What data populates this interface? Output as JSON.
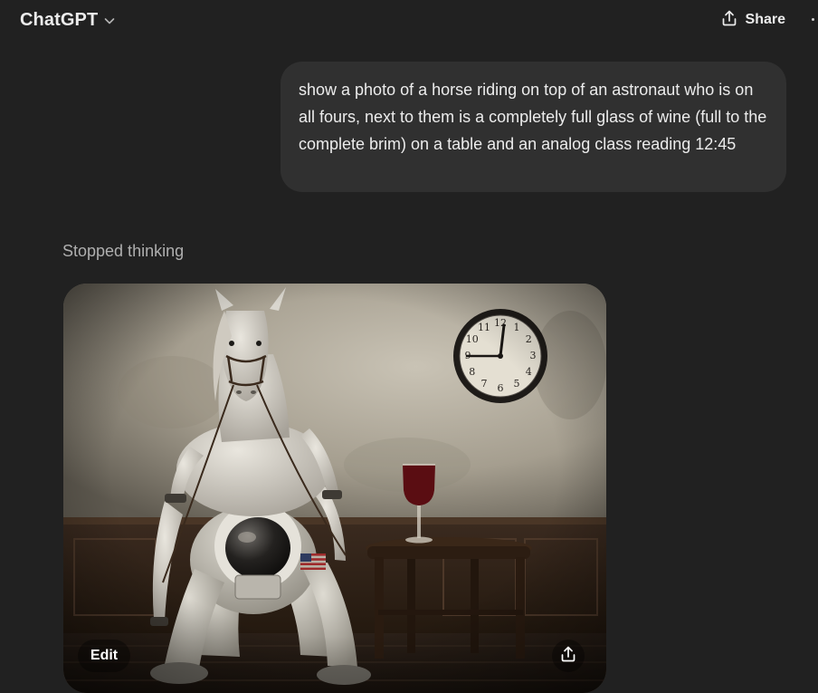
{
  "header": {
    "model_name": "ChatGPT",
    "model_chevron_icon": "chevron-down-icon",
    "share_label": "Share",
    "share_icon": "share-upload-icon",
    "more_icon": "more-dots-icon"
  },
  "conversation": {
    "user_message": "show a photo of a horse riding on top of an astronaut who is on all fours, next to them is a completely full glass of wine (full to the complete brim) on a table and an analog class reading 12:45",
    "assistant_status": "Stopped thinking",
    "generated_image": {
      "edit_label": "Edit",
      "download_icon": "download-icon",
      "clock_numerals": [
        "12",
        "1",
        "2",
        "3",
        "4",
        "5",
        "6",
        "7",
        "8",
        "9",
        "10",
        "11"
      ]
    }
  },
  "colors": {
    "background": "#212121",
    "bubble": "#303030",
    "text": "#ececec",
    "muted_text": "#afafaf"
  }
}
